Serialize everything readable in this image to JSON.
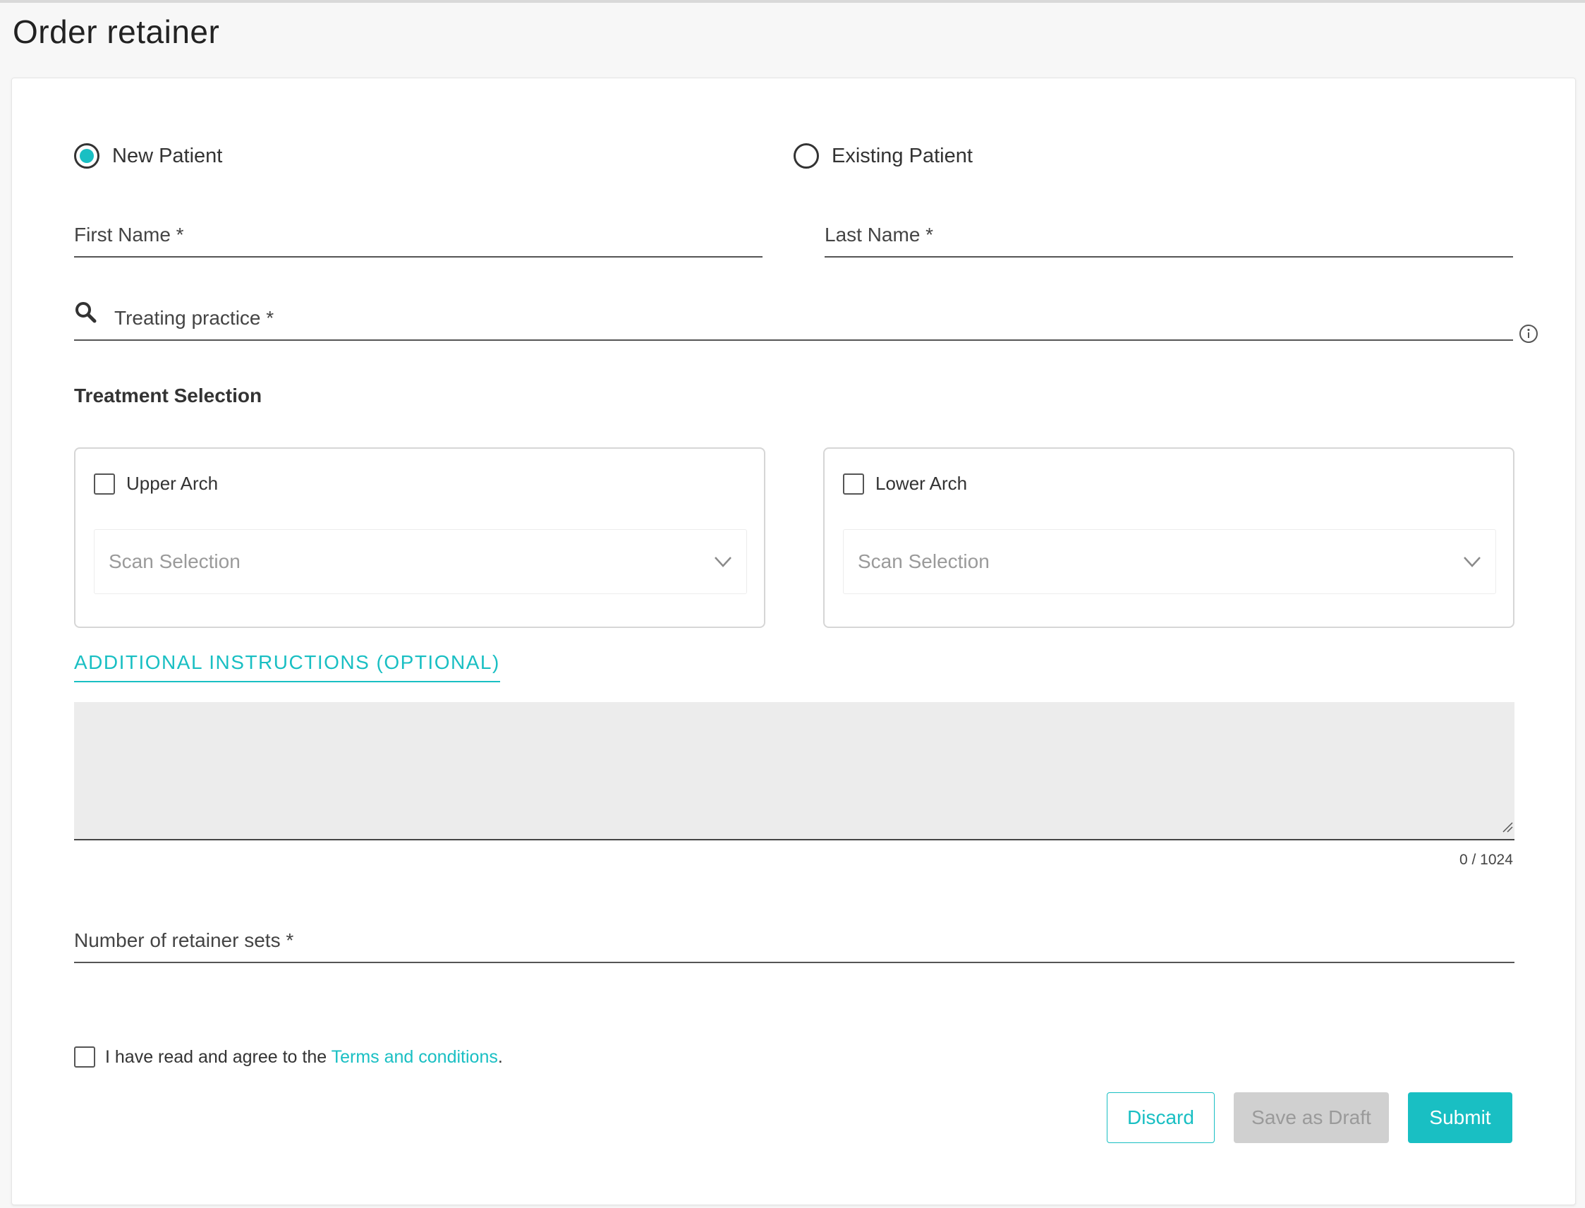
{
  "page": {
    "title": "Order retainer"
  },
  "patient_type": {
    "options": [
      {
        "label": "New Patient",
        "selected": true
      },
      {
        "label": "Existing Patient",
        "selected": false
      }
    ]
  },
  "fields": {
    "first_name_label": "First Name *",
    "last_name_label": "Last Name *",
    "treating_practice_label": "Treating practice *"
  },
  "treatment": {
    "section_title": "Treatment Selection",
    "upper": {
      "label": "Upper Arch",
      "checked": false,
      "scan_placeholder": "Scan Selection"
    },
    "lower": {
      "label": "Lower Arch",
      "checked": false,
      "scan_placeholder": "Scan Selection"
    }
  },
  "instructions": {
    "tab_label": "ADDITIONAL INSTRUCTIONS (OPTIONAL)",
    "value": "",
    "counter": "0 / 1024"
  },
  "retainer_sets": {
    "label": "Number of retainer sets *"
  },
  "terms": {
    "checked": false,
    "text_before": "I have read and agree to the ",
    "link_text": "Terms and conditions",
    "text_after": "."
  },
  "actions": {
    "discard_label": "Discard",
    "draft_label": "Save as Draft",
    "submit_label": "Submit"
  },
  "colors": {
    "accent": "#19bfc3",
    "disabled_bg": "#d0d0d0",
    "textarea_bg": "#ececec"
  },
  "icons": {
    "search": "search-icon",
    "info": "info-icon",
    "chevron": "chevron-down-icon",
    "resize": "resize-handle-icon"
  }
}
